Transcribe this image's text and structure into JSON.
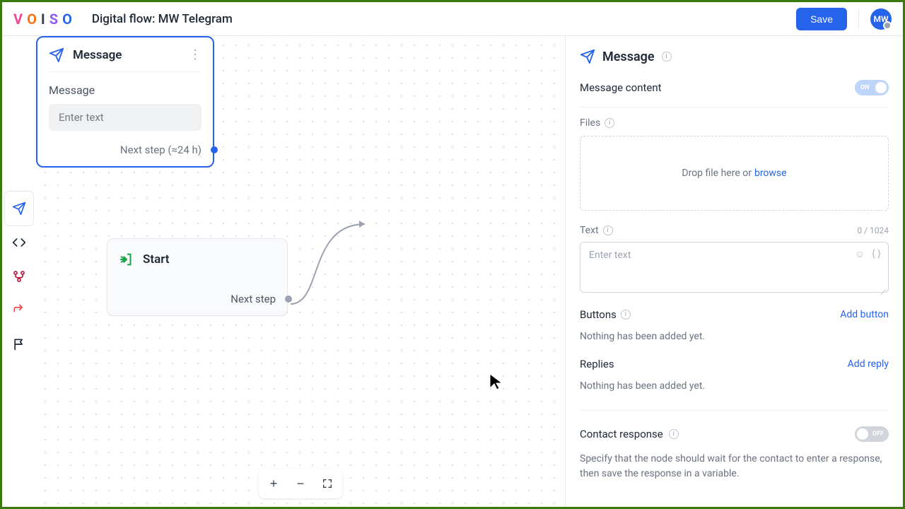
{
  "header": {
    "logo_letters": [
      "V",
      "O",
      "I",
      "S",
      "O"
    ],
    "title": "Digital flow: MW Telegram",
    "save_label": "Save",
    "avatar_initials": "MW"
  },
  "toolbar": {
    "tools": [
      {
        "name": "send-icon",
        "color": "#2563eb",
        "active": true
      },
      {
        "name": "code-icon",
        "color": "#1f2937"
      },
      {
        "name": "branch-icon",
        "color": "#be123c"
      },
      {
        "name": "redirect-icon",
        "color": "#ef4444"
      },
      {
        "name": "flag-icon",
        "color": "#1f2937"
      }
    ]
  },
  "canvas": {
    "start_node": {
      "title": "Start",
      "footer": "Next step"
    },
    "message_node": {
      "title": "Message",
      "field_label": "Message",
      "placeholder": "Enter text",
      "footer": "Next step (≈24 h)"
    },
    "zoom": {
      "in": "+",
      "out": "−"
    }
  },
  "panel": {
    "title": "Message",
    "message_content": {
      "label": "Message content",
      "toggle": "ON"
    },
    "files": {
      "label": "Files",
      "drop_prefix": "Drop file here or",
      "browse": "browse"
    },
    "text": {
      "label": "Text",
      "counter": "0 / 1024",
      "placeholder": "Enter text"
    },
    "buttons": {
      "label": "Buttons",
      "action": "Add button",
      "empty": "Nothing has been added yet."
    },
    "replies": {
      "label": "Replies",
      "action": "Add reply",
      "empty": "Nothing has been added yet."
    },
    "contact_response": {
      "label": "Contact response",
      "toggle": "OFF",
      "description": "Specify that the node should wait for the contact to enter a response, then save the response in a variable."
    }
  }
}
